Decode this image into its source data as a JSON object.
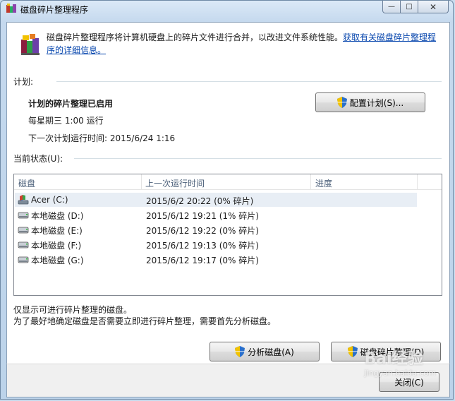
{
  "window": {
    "title": "磁盘碎片整理程序",
    "minimize_glyph": "—",
    "maximize_glyph": "□",
    "close_glyph": "✕"
  },
  "header": {
    "description": "磁盘碎片整理程序将计算机硬盘上的碎片文件进行合并，以改进文件系统性能。",
    "link_text": "获取有关磁盘碎片整理程序的详细信息。"
  },
  "schedule": {
    "section_label": "计划:",
    "enabled_text": "计划的碎片整理已启用",
    "frequency": "每星期三  1:00 运行",
    "next_run": "下一次计划运行时间: 2015/6/24 1:16",
    "configure_button": "配置计划(S)..."
  },
  "status": {
    "section_label": "当前状态(U):",
    "columns": [
      "磁盘",
      "上一次运行时间",
      "进度"
    ],
    "disks": [
      {
        "name": "Acer (C:)",
        "last_run": "2015/6/2 20:22 (0% 碎片)",
        "progress": "",
        "icon": "system-drive-icon"
      },
      {
        "name": "本地磁盘 (D:)",
        "last_run": "2015/6/12 19:21 (1% 碎片)",
        "progress": "",
        "icon": "hard-drive-icon"
      },
      {
        "name": "本地磁盘 (E:)",
        "last_run": "2015/6/12 19:22 (0% 碎片)",
        "progress": "",
        "icon": "hard-drive-icon"
      },
      {
        "name": "本地磁盘 (F:)",
        "last_run": "2015/6/12 19:13 (0% 碎片)",
        "progress": "",
        "icon": "hard-drive-icon"
      },
      {
        "name": "本地磁盘 (G:)",
        "last_run": "2015/6/12 19:17 (0% 碎片)",
        "progress": "",
        "icon": "hard-drive-icon"
      }
    ]
  },
  "notes": {
    "line1": "仅显示可进行碎片整理的磁盘。",
    "line2": "为了最好地确定磁盘是否需要立即进行碎片整理，需要首先分析磁盘。"
  },
  "actions": {
    "analyze_button": "分析磁盘(A)",
    "defrag_button": "磁盘碎片整理(D)",
    "close_button": "关闭(C)"
  },
  "watermark": {
    "text": "Bai经验",
    "sub": "jingyan.baidu.com"
  }
}
